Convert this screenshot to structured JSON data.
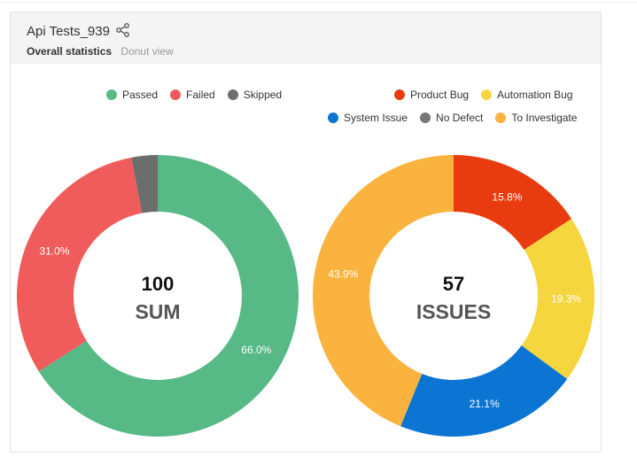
{
  "widget": {
    "title": "Api Tests_939",
    "subtitle_stat": "Overall statistics",
    "subtitle_view": "Donut view",
    "share_icon": "share-icon"
  },
  "legend_left": [
    {
      "label": "Passed",
      "color": "#56b986"
    },
    {
      "label": "Failed",
      "color": "#f05c5c"
    },
    {
      "label": "Skipped",
      "color": "#6d6d6d"
    }
  ],
  "legend_right_row1": [
    {
      "label": "Product Bug",
      "color": "#e83c10"
    },
    {
      "label": "Automation Bug",
      "color": "#f5d63f"
    }
  ],
  "legend_right_row2": [
    {
      "label": "System Issue",
      "color": "#0c74d3"
    },
    {
      "label": "No Defect",
      "color": "#777777"
    },
    {
      "label": "To Investigate",
      "color": "#fbb33f"
    }
  ],
  "chart_data": [
    {
      "type": "pie",
      "donut": true,
      "center_value": "100",
      "center_label": "SUM",
      "slices": [
        {
          "label": "Passed",
          "value": 66.0,
          "display": "66.0%",
          "color": "#56b986"
        },
        {
          "label": "Failed",
          "value": 31.0,
          "display": "31.0%",
          "color": "#f05c5c"
        },
        {
          "label": "Skipped",
          "value": 3.0,
          "display": "",
          "color": "#6d6d6d"
        }
      ]
    },
    {
      "type": "pie",
      "donut": true,
      "center_value": "57",
      "center_label": "ISSUES",
      "slices": [
        {
          "label": "Product Bug",
          "value": 15.8,
          "display": "15.8%",
          "color": "#e83c10"
        },
        {
          "label": "Automation Bug",
          "value": 19.3,
          "display": "19.3%",
          "color": "#f5d63f"
        },
        {
          "label": "System Issue",
          "value": 21.1,
          "display": "21.1%",
          "color": "#0c74d3"
        },
        {
          "label": "No Defect",
          "value": 0,
          "display": "",
          "color": "#777777"
        },
        {
          "label": "To Investigate",
          "value": 43.9,
          "display": "43.9%",
          "color": "#fbb33f"
        }
      ]
    }
  ]
}
